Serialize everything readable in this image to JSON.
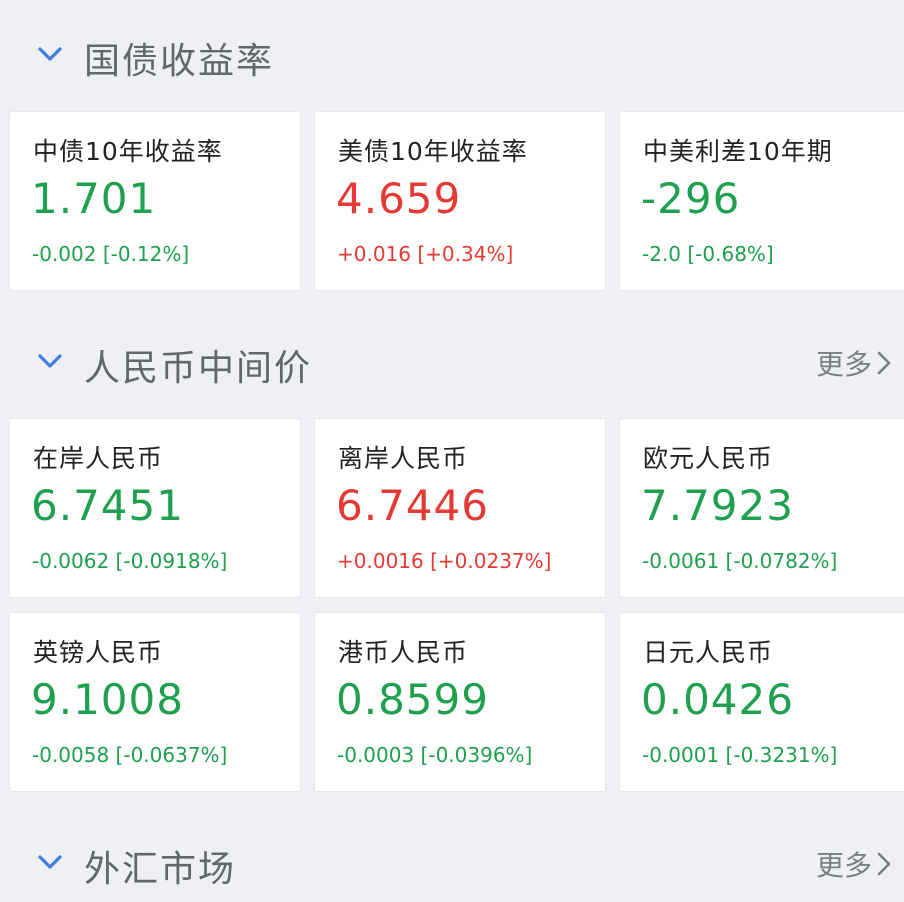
{
  "colors": {
    "down": "#1ea04f",
    "up": "#e53a33",
    "section_title": "#62666d",
    "chevron": "#3f7de0"
  },
  "sections": [
    {
      "title": "国债收益率",
      "more": "",
      "cards": [
        {
          "name": "中债10年收益率",
          "value": "1.701",
          "change": "-0.002 [-0.12%]",
          "direction": "down"
        },
        {
          "name": "美债10年收益率",
          "value": "4.659",
          "change": "+0.016 [+0.34%]",
          "direction": "up"
        },
        {
          "name": "中美利差10年期",
          "value": "-296",
          "change": "-2.0 [-0.68%]",
          "direction": "down"
        }
      ]
    },
    {
      "title": "人民币中间价",
      "more": "更多",
      "cards": [
        {
          "name": "在岸人民币",
          "value": "6.7451",
          "change": "-0.0062 [-0.0918%]",
          "direction": "down"
        },
        {
          "name": "离岸人民币",
          "value": "6.7446",
          "change": "+0.0016 [+0.0237%]",
          "direction": "up"
        },
        {
          "name": "欧元人民币",
          "value": "7.7923",
          "change": "-0.0061 [-0.0782%]",
          "direction": "down"
        },
        {
          "name": "英镑人民币",
          "value": "9.1008",
          "change": "-0.0058 [-0.0637%]",
          "direction": "down"
        },
        {
          "name": "港币人民币",
          "value": "0.8599",
          "change": "-0.0003 [-0.0396%]",
          "direction": "down"
        },
        {
          "name": "日元人民币",
          "value": "0.0426",
          "change": "-0.0001 [-0.3231%]",
          "direction": "down"
        }
      ]
    },
    {
      "title": "外汇市场",
      "more": "更多",
      "cards": []
    }
  ],
  "icons": {
    "collapse": "chevron-down-icon",
    "more": "chevron-right-icon"
  }
}
